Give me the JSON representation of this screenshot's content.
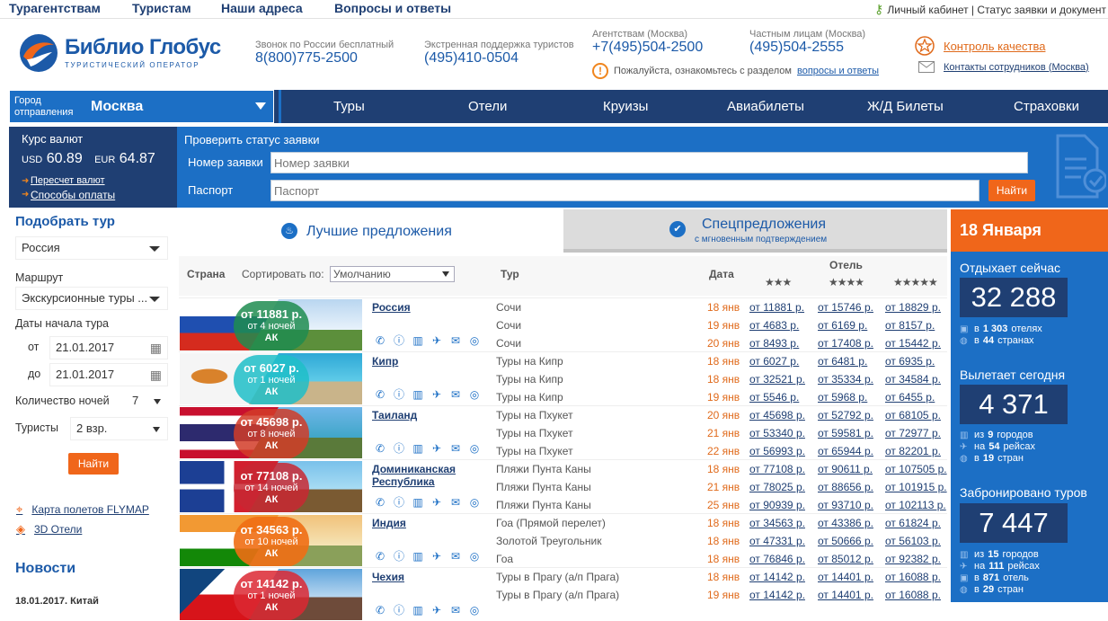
{
  "topnav": {
    "links": [
      "Турагентствам",
      "Туристам",
      "Наши адреса",
      "Вопросы и ответы"
    ],
    "right": "Личный кабинет | Статус заявки и документ"
  },
  "logo": {
    "name": "Библио Глобус",
    "tagline": "ТУРИСТИЧЕСКИЙ ОПЕРАТОР"
  },
  "phones": [
    {
      "title": "Звонок по России бесплатный",
      "value": "8(800)775-2500"
    },
    {
      "title": "Экстренная поддержка туристов",
      "value": "(495)410-0504"
    },
    {
      "title": "Агентствам (Москва)",
      "value": "+7(495)504-2500"
    },
    {
      "title": "Частным лицам (Москва)",
      "value": "(495)504-2555"
    }
  ],
  "notice": {
    "text": "Пожалуйста, ознакомьтесь с разделом",
    "link": "вопросы и ответы"
  },
  "quality_link": "Контроль качества",
  "contacts_link": "Контакты сотрудников (Москва)",
  "city": {
    "label": "Город отправления",
    "value": "Москва"
  },
  "nav": [
    "Туры",
    "Отели",
    "Круизы",
    "Авиабилеты",
    "Ж/Д Билеты",
    "Страховки"
  ],
  "rates": {
    "title": "Курс валют",
    "usd_label": "USD",
    "usd": "60.89",
    "eur_label": "EUR",
    "eur": "64.87",
    "link1": "Пересчет валют",
    "link2": "Способы оплаты"
  },
  "check": {
    "title": "Проверить статус заявки",
    "order_label": "Номер заявки",
    "order_placeholder": "Номер заявки",
    "passport_label": "Паспорт",
    "passport_placeholder": "Паспорт",
    "button": "Найти"
  },
  "search": {
    "title": "Подобрать тур",
    "country": "Россия",
    "route_label": "Маршрут",
    "route": "Экскурсионные туры ...",
    "dates_label": "Даты начала тура",
    "from_label": "от",
    "from": "21.01.2017",
    "to_label": "до",
    "to": "21.01.2017",
    "nights_label": "Количество ночей",
    "nights": "7",
    "tourists_label": "Туристы",
    "tourists": "2 взр.",
    "button": "Найти"
  },
  "sidelinks": [
    "Карта полетов FLYMAP",
    "3D Отели"
  ],
  "news": {
    "title": "Новости",
    "first": "18.01.2017. Китай"
  },
  "tabs": {
    "best": "Лучшие предложения",
    "special": "Спецпредложения",
    "special_sub": "с мгновенным подтверждением"
  },
  "table": {
    "country": "Страна",
    "sort_label": "Сортировать по:",
    "sort_value": "Умолчанию",
    "tour": "Тур",
    "date": "Дата",
    "hotel": "Отель",
    "stars": [
      "★★★",
      "★★★★",
      "★★★★★"
    ]
  },
  "offers": [
    {
      "country": "Россия",
      "price": "от 11881 р.",
      "nights": "от 4 ночей",
      "ak": "АК",
      "flag": "russia",
      "rows": [
        {
          "tour": "Сочи",
          "date": "18 янв",
          "p1": "от 11881 р.",
          "p2": "от 15746 р.",
          "p3": "от 18829 р."
        },
        {
          "tour": "Сочи",
          "date": "19 янв",
          "p1": "от 4683 р.",
          "p2": "от 6169 р.",
          "p3": "от 8157 р."
        },
        {
          "tour": "Сочи",
          "date": "20 янв",
          "p1": "от 8493 р.",
          "p2": "от 17408 р.",
          "p3": "от 15442 р."
        }
      ]
    },
    {
      "country": "Кипр",
      "price": "от 6027 р.",
      "nights": "от 1 ночей",
      "ak": "АК",
      "flag": "cyprus",
      "rows": [
        {
          "tour": "Туры на Кипр",
          "date": "18 янв",
          "p1": "от 6027 р.",
          "p2": "от 6481 р.",
          "p3": "от 6935 р."
        },
        {
          "tour": "Туры на Кипр",
          "date": "18 янв",
          "p1": "от 32521 р.",
          "p2": "от 35334 р.",
          "p3": "от 34584 р."
        },
        {
          "tour": "Туры на Кипр",
          "date": "19 янв",
          "p1": "от 5546 р.",
          "p2": "от 5968 р.",
          "p3": "от 6455 р."
        }
      ]
    },
    {
      "country": "Таиланд",
      "price": "от 45698 р.",
      "nights": "от 8 ночей",
      "ak": "АК",
      "flag": "thailand",
      "rows": [
        {
          "tour": "Туры на Пхукет",
          "date": "20 янв",
          "p1": "от 45698 р.",
          "p2": "от 52792 р.",
          "p3": "от 68105 р."
        },
        {
          "tour": "Туры на Пхукет",
          "date": "21 янв",
          "p1": "от 53340 р.",
          "p2": "от 59581 р.",
          "p3": "от 72977 р."
        },
        {
          "tour": "Туры на Пхукет",
          "date": "22 янв",
          "p1": "от 56993 р.",
          "p2": "от 65944 р.",
          "p3": "от 82201 р."
        }
      ]
    },
    {
      "country": "Доминиканская Республика",
      "price": "от 77108 р.",
      "nights": "от 14 ночей",
      "ak": "АК",
      "flag": "dominican",
      "rows": [
        {
          "tour": "Пляжи Пунта Каны",
          "date": "18 янв",
          "p1": "от 77108 р.",
          "p2": "от 90611 р.",
          "p3": "от 107505 р."
        },
        {
          "tour": "Пляжи Пунта Каны",
          "date": "21 янв",
          "p1": "от 78025 р.",
          "p2": "от 88656 р.",
          "p3": "от 101915 р."
        },
        {
          "tour": "Пляжи Пунта Каны",
          "date": "25 янв",
          "p1": "от 90939 р.",
          "p2": "от 93710 р.",
          "p3": "от 102113 р."
        }
      ]
    },
    {
      "country": "Индия",
      "price": "от 34563 р.",
      "nights": "от 10 ночей",
      "ak": "АК",
      "flag": "india",
      "rows": [
        {
          "tour": "Гоа (Прямой перелет)",
          "date": "18 янв",
          "p1": "от 34563 р.",
          "p2": "от 43386 р.",
          "p3": "от 61824 р."
        },
        {
          "tour": "Золотой Треугольник",
          "date": "18 янв",
          "p1": "от 47331 р.",
          "p2": "от 50666 р.",
          "p3": "от 56103 р."
        },
        {
          "tour": "Гоа",
          "date": "18 янв",
          "p1": "от 76846 р.",
          "p2": "от 85012 р.",
          "p3": "от 92382 р."
        }
      ]
    },
    {
      "country": "Чехия",
      "price": "от 14142 р.",
      "nights": "от 1 ночей",
      "ak": "АК",
      "flag": "czech",
      "rows": [
        {
          "tour": "Туры в Прагу (а/п Прага)",
          "date": "18 янв",
          "p1": "от 14142 р.",
          "p2": "от 14401 р.",
          "p3": "от 16088 р."
        },
        {
          "tour": "Туры в Прагу (а/п Прага)",
          "date": "19 янв",
          "p1": "от 14142 р.",
          "p2": "от 14401 р.",
          "p3": "от 16088 р."
        }
      ]
    }
  ],
  "stats": {
    "date": "18 Января",
    "resting": {
      "title": "Отдыхает сейчас",
      "value": "32 288",
      "l1a": "в",
      "l1b": "1 303",
      "l1c": "отелях",
      "l2a": "в",
      "l2b": "44",
      "l2c": "странах"
    },
    "departing": {
      "title": "Вылетает сегодня",
      "value": "4 371",
      "l1a": "из",
      "l1b": "9",
      "l1c": "городов",
      "l2a": "на",
      "l2b": "54",
      "l2c": "рейсах",
      "l3a": "в",
      "l3b": "19",
      "l3c": "стран"
    },
    "booked": {
      "title": "Забронировано туров",
      "value": "7 447",
      "l1a": "из",
      "l1b": "15",
      "l1c": "городов",
      "l2a": "на",
      "l2b": "111",
      "l2c": "рейсах",
      "l3a": "в",
      "l3b": "871",
      "l3c": "отель",
      "l4a": "в",
      "l4b": "29",
      "l4c": "стран"
    }
  }
}
